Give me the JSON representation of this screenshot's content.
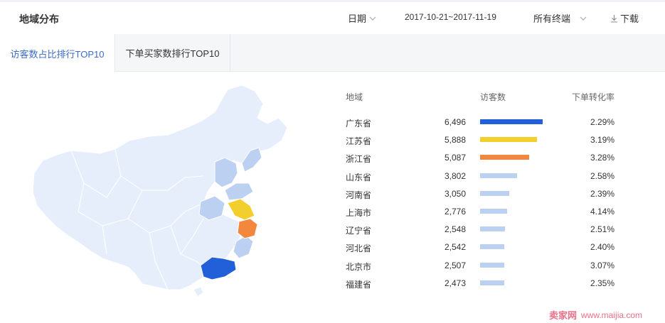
{
  "header": {
    "title": "地域分布",
    "date_label": "日期",
    "date_range": "2017-10-21~2017-11-19",
    "terminal_label": "所有终端",
    "download_label": "下载"
  },
  "tabs": [
    {
      "label": "访客数占比排行TOP10",
      "active": true
    },
    {
      "label": "下单买家数排行TOP10",
      "active": false
    }
  ],
  "table": {
    "columns": [
      "地域",
      "访客数",
      "下单转化率"
    ],
    "rows": [
      {
        "region": "广东省",
        "visitors": "6,496",
        "visitors_num": 6496,
        "rate": "2.29%",
        "color": "#2160d8"
      },
      {
        "region": "江苏省",
        "visitors": "5,888",
        "visitors_num": 5888,
        "rate": "3.19%",
        "color": "#f2cf2c"
      },
      {
        "region": "浙江省",
        "visitors": "5,087",
        "visitors_num": 5087,
        "rate": "3.28%",
        "color": "#f3873d"
      },
      {
        "region": "山东省",
        "visitors": "3,802",
        "visitors_num": 3802,
        "rate": "2.58%",
        "color": "#bcd0f2"
      },
      {
        "region": "河南省",
        "visitors": "3,050",
        "visitors_num": 3050,
        "rate": "2.39%",
        "color": "#bcd0f2"
      },
      {
        "region": "上海市",
        "visitors": "2,776",
        "visitors_num": 2776,
        "rate": "4.14%",
        "color": "#bcd0f2"
      },
      {
        "region": "辽宁省",
        "visitors": "2,548",
        "visitors_num": 2548,
        "rate": "2.51%",
        "color": "#bcd0f2"
      },
      {
        "region": "河北省",
        "visitors": "2,542",
        "visitors_num": 2542,
        "rate": "2.40%",
        "color": "#bcd0f2"
      },
      {
        "region": "北京市",
        "visitors": "2,507",
        "visitors_num": 2507,
        "rate": "3.07%",
        "color": "#bcd0f2"
      },
      {
        "region": "福建省",
        "visitors": "2,473",
        "visitors_num": 2473,
        "rate": "2.35%",
        "color": "#bcd0f2"
      }
    ]
  },
  "watermark": {
    "brand": "卖家网",
    "url": "www.maijia.com"
  },
  "colors": {
    "accent": "#3c6cc6",
    "map_base": "#e7eefb",
    "map_light": "#bcd0f2"
  }
}
